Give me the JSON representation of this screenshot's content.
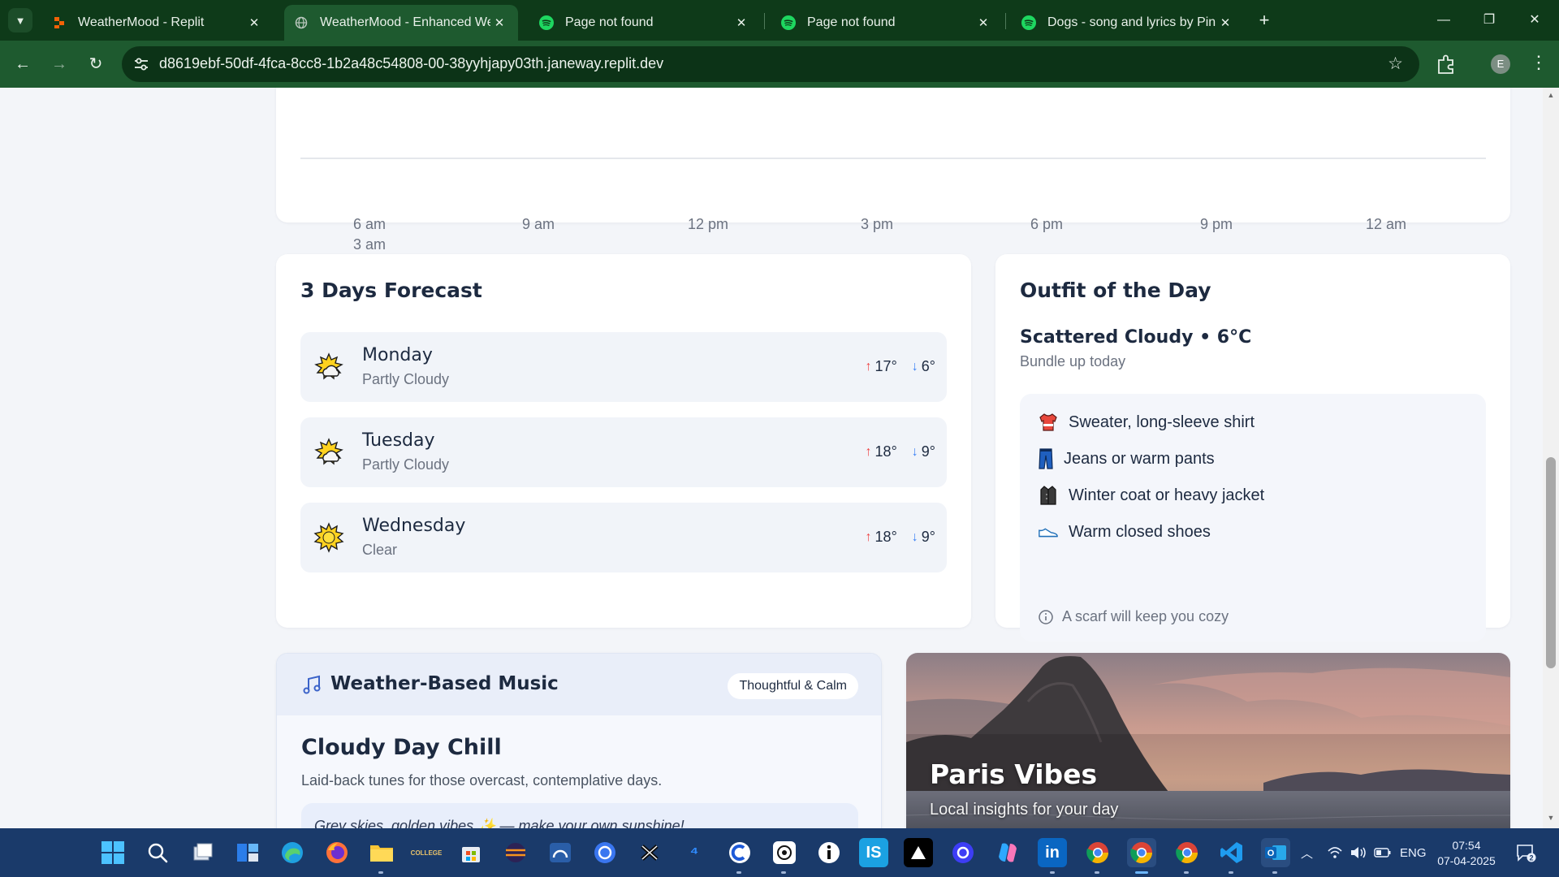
{
  "browser": {
    "tabs": [
      {
        "title": "WeatherMood - Replit",
        "favicon": "replit-icon",
        "active": false
      },
      {
        "title": "WeatherMood - Enhanced Wea",
        "favicon": "globe-icon",
        "active": true
      },
      {
        "title": "Page not found",
        "favicon": "spotify-icon",
        "active": false
      },
      {
        "title": "Page not found",
        "favicon": "spotify-icon",
        "active": false
      },
      {
        "title": "Dogs - song and lyrics by Pink F",
        "favicon": "spotify-icon",
        "active": false
      }
    ],
    "url": "d8619ebf-50df-4fca-8cc8-1b2a48c54808-00-38yyhjapy03th.janeway.replit.dev",
    "profile_initial": "E"
  },
  "timeline": {
    "hours": [
      "6 am",
      "9 am",
      "12 pm",
      "3 pm",
      "6 pm",
      "9 pm",
      "12 am"
    ],
    "extra_label": "3 am"
  },
  "forecast": {
    "title": "3 Days Forecast",
    "days": [
      {
        "name": "Monday",
        "condition": "Partly Cloudy",
        "high": "17°",
        "low": "6°",
        "icon": "partly-cloudy-icon"
      },
      {
        "name": "Tuesday",
        "condition": "Partly Cloudy",
        "high": "18°",
        "low": "9°",
        "icon": "partly-cloudy-icon"
      },
      {
        "name": "Wednesday",
        "condition": "Clear",
        "high": "18°",
        "low": "9°",
        "icon": "sun-icon"
      }
    ]
  },
  "outfit": {
    "title": "Outfit of the Day",
    "summary": "Scattered Cloudy • 6°C",
    "subtitle": "Bundle up today",
    "items": [
      {
        "label": "Sweater, long-sleeve shirt",
        "icon": "sweater-icon"
      },
      {
        "label": "Jeans or warm pants",
        "icon": "jeans-icon"
      },
      {
        "label": "Winter coat or heavy jacket",
        "icon": "coat-icon"
      },
      {
        "label": "Warm closed shoes",
        "icon": "shoe-icon"
      }
    ],
    "tip": "A scarf will keep you cozy"
  },
  "music": {
    "header": "Weather-Based Music",
    "mood": "Thoughtful & Calm",
    "playlist_title": "Cloudy Day Chill",
    "playlist_desc": "Laid-back tunes for those overcast, contemplative days.",
    "quote": "Grey skies, golden vibes ✨ — make your own sunshine!"
  },
  "city": {
    "name": "Paris Vibes",
    "subtitle": "Local insights for your day"
  },
  "taskbar": {
    "language": "ENG",
    "time": "07:54",
    "date": "07-04-2025",
    "notifications": "2"
  },
  "colors": {
    "chrome_dark": "#0e3a19",
    "chrome_toolbar": "#1e5a2f",
    "page_bg": "#f3f5f9",
    "temp_high": "#ef4444",
    "temp_low": "#3b82f6",
    "taskbar": "#1a3a6a"
  }
}
